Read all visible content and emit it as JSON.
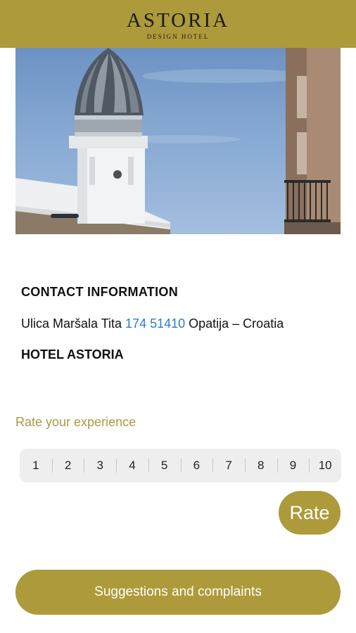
{
  "header": {
    "brand": "ASTORIA",
    "subtitle": "DESIGN HOTEL",
    "color": "#ad9a3a"
  },
  "hero": {
    "icon": "hotel-photo"
  },
  "contact": {
    "title": "CONTACT INFORMATION",
    "address_street": "Ulica Maršala Tita ",
    "address_phone": "174 51410",
    "address_city": " Opatija – Croatia",
    "phone_color": "#2a7ad6",
    "hotel_name": "HOTEL ASTORIA"
  },
  "rating": {
    "label": "Rate your experience",
    "options": [
      "1",
      "2",
      "3",
      "4",
      "5",
      "6",
      "7",
      "8",
      "9",
      "10"
    ],
    "rate_button": "Rate"
  },
  "actions": {
    "suggestions": "Suggestions and complaints"
  }
}
